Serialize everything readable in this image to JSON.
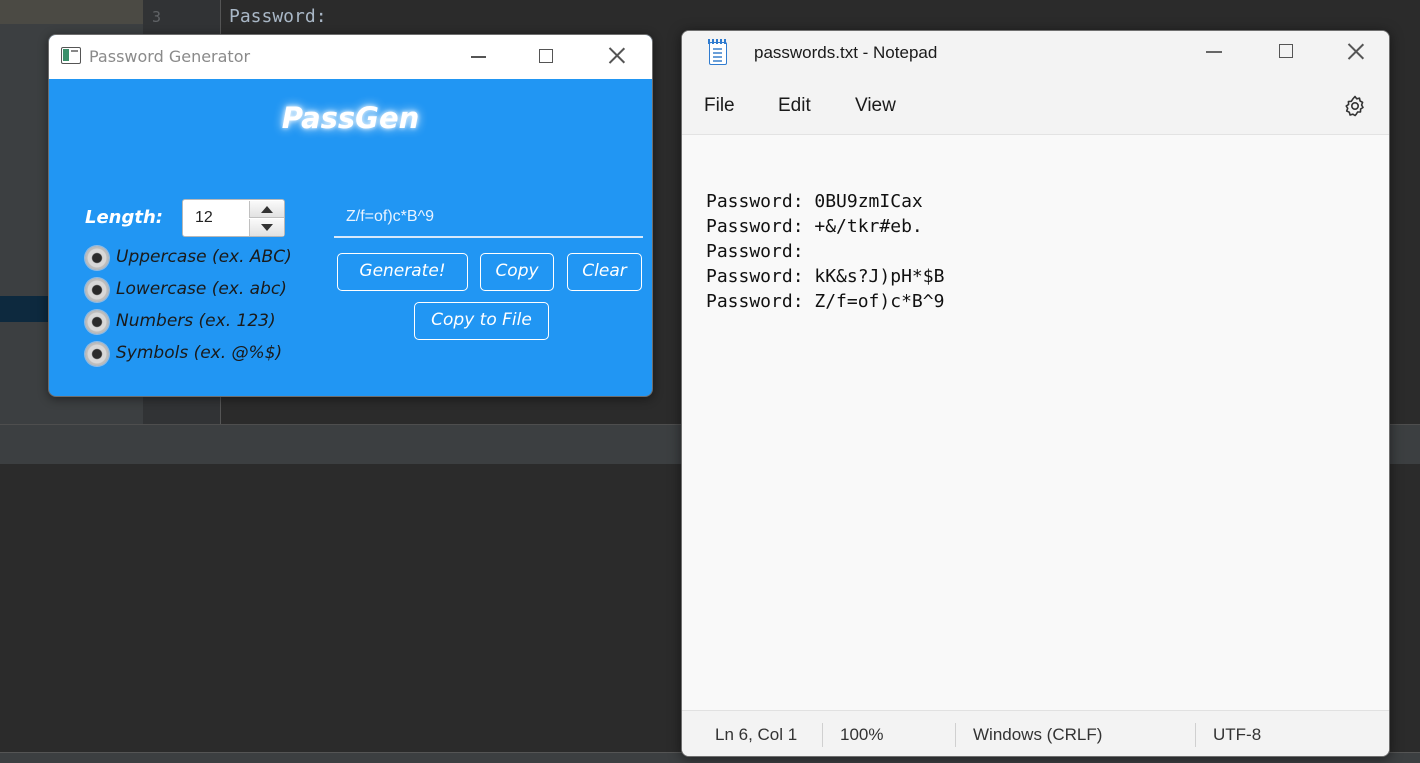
{
  "ide": {
    "line_number": "3",
    "code_line": "Password:"
  },
  "generator": {
    "window_title": "Password Generator",
    "brand": "PassGen",
    "length_label": "Length:",
    "length_value": "12",
    "options": [
      {
        "label": "Uppercase (ex. ABC)",
        "selected": true
      },
      {
        "label": "Lowercase (ex. abc)",
        "selected": true
      },
      {
        "label": "Numbers (ex. 123)",
        "selected": true
      },
      {
        "label": "Symbols (ex. @%$)",
        "selected": true
      }
    ],
    "password_output": "Z/f=of)c*B^9",
    "buttons": {
      "generate": "Generate!",
      "copy": "Copy",
      "clear": "Clear",
      "copy_to_file": "Copy to File"
    },
    "colors": {
      "background": "#2196f3",
      "text": "#ffffff"
    }
  },
  "notepad": {
    "window_title": "passwords.txt - Notepad",
    "menu": [
      "File",
      "Edit",
      "View"
    ],
    "lines": [
      "Password: 0BU9zmICax",
      "Password: +&/tkr#eb.",
      "Password:",
      "Password: kK&s?J)pH*$B",
      "Password: Z/f=of)c*B^9"
    ],
    "status": {
      "position": "Ln 6, Col 1",
      "zoom": "100%",
      "line_ending": "Windows (CRLF)",
      "encoding": "UTF-8"
    }
  }
}
